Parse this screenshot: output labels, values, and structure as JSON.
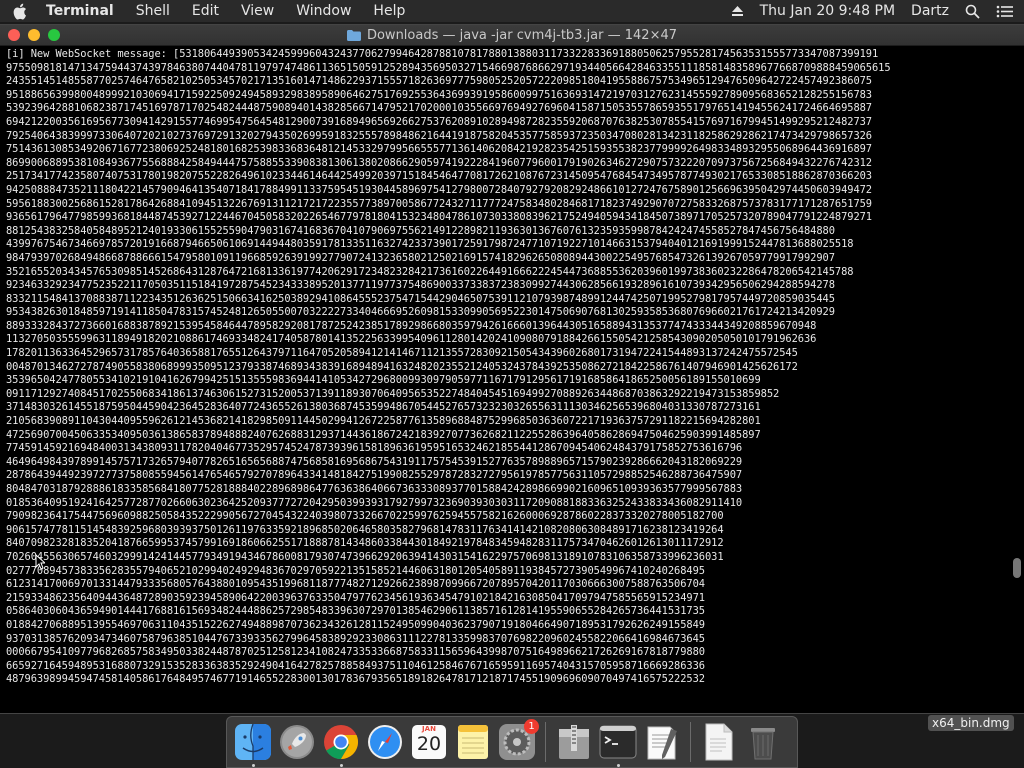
{
  "menubar": {
    "app_name": "Terminal",
    "menus": [
      "Shell",
      "Edit",
      "View",
      "Window",
      "Help"
    ],
    "datetime": "Thu Jan 20  9:48 PM",
    "user": "Dartz"
  },
  "window": {
    "title": "Downloads — java -jar cvm4j-tb3.jar — 142×47",
    "lines": [
      "[i] New WebSocket message: [53180644939053424599960432437706279946428788107817880138803117332283369188050625795528174563531555773347087399191",
      "97550981814713475944374397846380744047811979747486113651505912528943569503271546698768662971934405664284633551118581483589677668709888459065615",
      "24355145148558770257464765821025053457021713516014714862293715557182636977759805252057222098518041955886757534965129476509642722457492386075",
      "95188656399800489992103069417159225092494589329838958906462751769255364369939195860099751636931472197031276231455592789095683652128255156783",
      "53923964288106823871745169787170254824448759089401438285667147952170200010355669769492769604158715053557865935517976514194556241724664695887",
      "69421220035616956773094142915577469954756454812900739168949656926627537620891028949872823559206870763825307855415769716799451499295212482737",
      "79254064383999733064072021027376972913202794350269959183255578984862164419187582045357758593723503470802813423118258629286217473429798657326",
      "75143613085349206716772380692524818016825398336836481214533297995665557713614062084219282354251593553823779999264983348932955068964436916897",
      "86990068895381084936775568884258494447575885533908381306138020866290597419222841960779600179190263462729075732220709737567256849432276742312",
      "25173417742358074075317801982075522826496102334461464425499203971518454647708172621087672314509547684547349578774930217653308518862870366203",
      "94250888473521118042214579094641354071841788499113375954519304458969754127980072840792792082924866101272476758901256696395042974450603949472",
      "59561883002568615281786426884109451322676913112172172235577389700586772432711777247583480284681718237492907072758332687573783177171287651759",
      "93656179647798599368184487453927122446704505832022654677978180415323480478610730338083962175249405943418450738971705257320789047791224879271",
      "88125438325840584895212401933061552559047903167416836704107906975562149122898211936301367607613235935998784242474558527847456756484880",
      "43997675467346697857201916687946650610691449448035917813351163274233739017259179872477107192271014663153794040121691999152447813688025518",
      "98479397026849486687886661547958010911966859263919927790724132365802125021691574182962650808944300225495768547326139267059779917992907",
      "35216552034345765309851452686431287647216813361977420629172348232842173616022644916662224544736885536203960199738360232286478206542145788",
      "92346332923477523522117050351151841972875452343338952013771197737548690033733837238309927443062856619328961610739342956506294288594278",
      "83321154841370883871122343512636251506634162503892941086455523754715442904650753911210793987489912447425071995279817957449720859035445",
      "95343826301848597191411850478315745248126505500703222273340466695260981533099056952230147506907681302593585368076966021761724213420929",
      "88933328437273660168838789215395458464478958292081787252423851789298668035979426166601396443051658894313537747433344349208859670948",
      "11327050355599631189491820210886174693348241740587801413522563399540961128014202410908079188426615505421258543090205050101791962636",
      "17820113633645296573178576403658817655126437971164705205894121414671121355728309215054343960268017319472241544893137242475572545",
      "00487013462727874905583806899935095123793387468934383916894894163248202355212405324378439253508627218422586761407946901425626172",
      "35396504247780553410219104162679942515135559836944141053427296800993097905977116717912956171916858641865250056189155010699",
      "09117129274084517025506834186137463061527315200537139118930706409565352274840454516949927088926344868703863292219473153859852",
      "37148303261455187595044590423645283640772436552613803687453599486705445276573232303265563111303462565396804031330787273161",
      "21056839089110430440955962612145368214182985091144502994126722587761358968848752996850363607221719363757291182215694282801",
      "47256907004506335340950361386583789488824076268831293714436186724218392707736268211225528639640586286947504625903991485897",
      "77459145921694840031343809311782040467735295745247873939615818963619595165324621855441286709454062484379175852753616796",
      "46496498439789914575717326579407782651656568874756858169568675431911757545391527763578988965715790239286662043182069229",
      "28786439449239727737580855945614765465792707896433414818427519908255297872832727956197857756311057298852546288736475907",
      "80484703187928886183358568418077528188840228968986477636386406673633308937701588424289866990216096510939363577999567883",
      "01853640951924164257728770266063023642520937772720429503993931792799732369039303031172090881883363252433833436082911410",
      "79098236417544756960988250584352229905672704543224039807332667022599762594557582162600069287860228373320278005182700",
      "90615747781151454839259680393937501261197633592189685020646580358279681478311763414142108208063084891716238123419264",
      "84070982328183520418766599537457991691860662551718887814348603384430184921978483459482831175734704626012613011172912",
      "70260455630657460329991424144577934919434678600817930747396629206394143031541622975706981318910783106358733996236031",
      "02777089457383356283557940652102994024929483670297059221351585214460631801205405891193845727390549967410240268495",
      "61231417006970133144793335680576438801095435199681187774827129266238987099667207895704201170306663007588763506704",
      "21593348623564094436487289035923945890642200396376335047977623456193634547910218421630850417097947585565915234971",
      "05864030604365949014441768816156934824448862572985483396307297013854629061138571612814195590655284265736441531735",
      "01884270688951395546970631104351522627494889870736234326128115249509904036237907191804664907189531792626249155849",
      "93703138576209347346075879638510447673393356279964583892923308631112278133599837076982209602455822066416984673645",
      "00066795410977968268575834950338244878702512581234108247335336687583311565964399870751649896621726269167818779880",
      "66592716459489531688073291535283363835292490416427825788584937511046125846767165959116957404315705958716669286336",
      "48796398994594745814058617648495746771914655228300130178367935651891826478171218717455190969609070497416575222532"
    ]
  },
  "dock": {
    "apps": [
      "Finder",
      "Launchpad",
      "Google Chrome",
      "Safari",
      "Calendar",
      "Notes",
      "System Preferences",
      "Archive Utility",
      "Terminal",
      "TextEdit",
      "Document",
      "Trash"
    ],
    "calendar": {
      "month": "JAN",
      "day": "20"
    },
    "system_preferences_badge": "1"
  },
  "desktop": {
    "file_label": "x64_bin.dmg"
  },
  "colors": {
    "close": "#fd5f57",
    "minimize": "#febc2e",
    "maximize": "#28c840",
    "terminal_bg": "#000000",
    "terminal_fg": "#e8e8e8"
  }
}
